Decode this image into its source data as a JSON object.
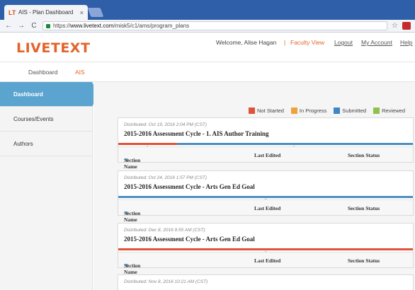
{
  "browser": {
    "tab_title": "AIS - Plan Dashboard",
    "tab_close": "×",
    "url_scheme": "https://",
    "url_domain": "www.livetext.com",
    "url_path": "/misk5/c1/ams/program_plans",
    "back_glyph": "←",
    "forward_glyph": "→",
    "reload_glyph": "C",
    "star_glyph": "☆"
  },
  "header": {
    "logo": "LIVETEXT",
    "welcome": "Welcome, Alise Hagan",
    "separator": "|",
    "faculty_view": "Faculty View",
    "logout": "Logout",
    "my_account": "My Account",
    "help": "Help"
  },
  "subnav": {
    "dashboard": "Dashboard",
    "ais": "AIS"
  },
  "sidebar": {
    "items": [
      {
        "label": "Dashboard"
      },
      {
        "label": "Courses/Events"
      },
      {
        "label": "Authors"
      }
    ]
  },
  "legend": {
    "items": [
      {
        "label": "Not Started",
        "color": "#e0533a"
      },
      {
        "label": "In Progress",
        "color": "#f0a23a"
      },
      {
        "label": "Submitted",
        "color": "#3f86c3"
      },
      {
        "label": "Reviewed",
        "color": "#8fc24c"
      }
    ]
  },
  "columns": {
    "section_name": "Section Name",
    "last_edited": "Last Edited",
    "section_status": "Section Status"
  },
  "cycles": [
    {
      "distributed": "Distributed: Oct 19, 2016 2:04 PM (CST)",
      "title": "2015-2016 Assessment Cycle - 1. AIS Author Training",
      "not_started_fraction": 0.2,
      "count_left": "1",
      "count_right": "4"
    },
    {
      "distributed": "Distributed: Oct 24, 2016 1:57 PM (CST)",
      "title": "2015-2016 Assessment Cycle - Arts Gen Ed Goal",
      "not_started_fraction": 0.0,
      "count_center": "5"
    },
    {
      "distributed": "Distributed: Dec 8, 2016 9:55 AM (CST)",
      "title": "2015-2016 Assessment Cycle - Arts Gen Ed Goal",
      "not_started_fraction": 1.0,
      "count_center": "5"
    },
    {
      "distributed": "Distributed: Nov 8, 2016 10:21 AM (CST)"
    }
  ]
}
